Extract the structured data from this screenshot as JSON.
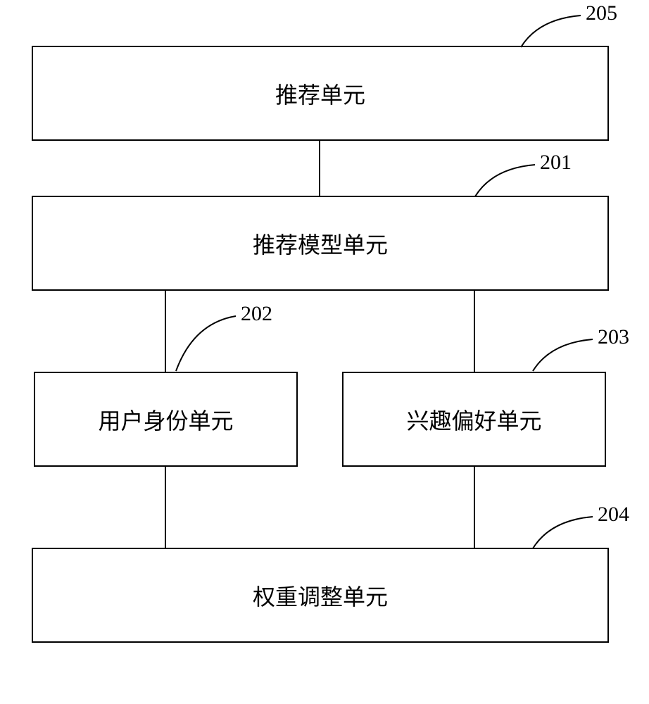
{
  "boxes": {
    "b205": {
      "label": "推荐单元",
      "ref": "205"
    },
    "b201": {
      "label": "推荐模型单元",
      "ref": "201"
    },
    "b202": {
      "label": "用户身份单元",
      "ref": "202"
    },
    "b203": {
      "label": "兴趣偏好单元",
      "ref": "203"
    },
    "b204": {
      "label": "权重调整单元",
      "ref": "204"
    }
  }
}
